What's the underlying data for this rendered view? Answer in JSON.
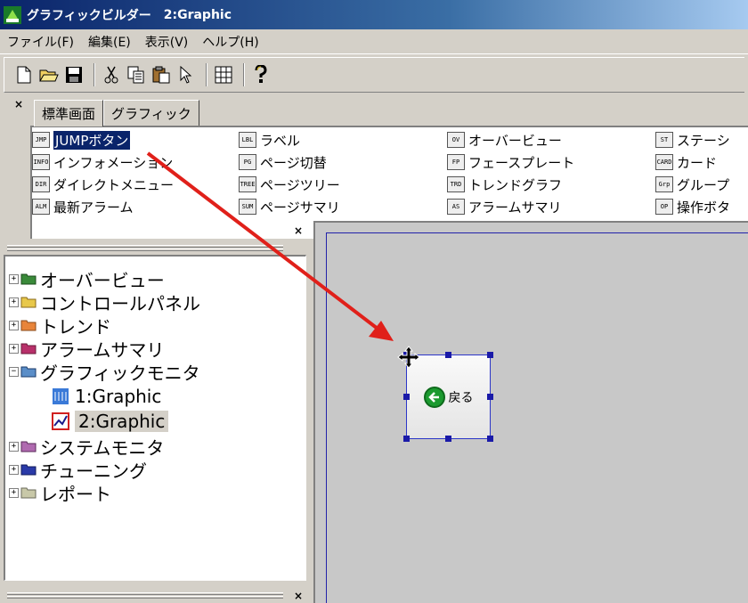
{
  "window": {
    "title_app": "グラフィックビルダー",
    "title_doc": "2:Graphic"
  },
  "menu": [
    "ファイル(F)",
    "編集(E)",
    "表示(V)",
    "ヘルプ(H)"
  ],
  "toolbar": {
    "icons": [
      "new-file-icon",
      "open-folder-icon",
      "save-icon",
      "cut-icon",
      "copy-icon",
      "paste-icon",
      "pointer-icon",
      "grid-icon",
      "help-icon"
    ]
  },
  "palette": {
    "close": "×",
    "tabs": [
      "標準画面",
      "グラフィック"
    ],
    "items": [
      {
        "label": "JUMPボタン",
        "icon": "jump-button-icon",
        "selected": true
      },
      {
        "label": "インフォメーション",
        "icon": "information-icon"
      },
      {
        "label": "ダイレクトメニュー",
        "icon": "direct-menu-icon"
      },
      {
        "label": "最新アラーム",
        "icon": "latest-alarm-icon"
      },
      {
        "label": "ラベル",
        "icon": "label-icon"
      },
      {
        "label": "ページ切替",
        "icon": "page-switch-icon"
      },
      {
        "label": "ページツリー",
        "icon": "page-tree-icon"
      },
      {
        "label": "ページサマリ",
        "icon": "page-summary-icon"
      },
      {
        "label": "オーバービュー",
        "icon": "overview-icon"
      },
      {
        "label": "フェースプレート",
        "icon": "faceplate-icon"
      },
      {
        "label": "トレンドグラフ",
        "icon": "trend-graph-icon"
      },
      {
        "label": "アラームサマリ",
        "icon": "alarm-summary-icon"
      },
      {
        "label": "ステーシ",
        "icon": "station-icon"
      },
      {
        "label": "カード",
        "icon": "card-icon"
      },
      {
        "label": "グループ",
        "icon": "group-icon"
      },
      {
        "label": "操作ボタ",
        "icon": "operation-button-icon"
      }
    ],
    "icon_text": [
      "JMP",
      "INFO",
      "DIR",
      "ALM",
      "LBL",
      "PG",
      "TREE",
      "SUM",
      "OV",
      "FP",
      "TRD",
      "AS",
      "ST",
      "CARD",
      "Grp",
      "OP"
    ]
  },
  "tree": {
    "nodes": [
      {
        "label": "オーバービュー",
        "folder_color": "#3a8a3a",
        "expander": "+"
      },
      {
        "label": "コントロールパネル",
        "folder_color": "#e8c84a",
        "expander": "+"
      },
      {
        "label": "トレンド",
        "folder_color": "#e8843a",
        "expander": "+"
      },
      {
        "label": "アラームサマリ",
        "folder_color": "#b8306a",
        "expander": "+"
      },
      {
        "label": "グラフィックモニタ",
        "folder_color": "#5b8ec8",
        "expander": "−"
      },
      {
        "label": "1:Graphic",
        "child": true
      },
      {
        "label": "2:Graphic",
        "child": true,
        "selected": true
      },
      {
        "label": "システムモニタ",
        "folder_color": "#b06ab0",
        "expander": "+"
      },
      {
        "label": "チューニング",
        "folder_color": "#2a3aa8",
        "expander": "+"
      },
      {
        "label": "レポート",
        "folder_color": "#c8c8a8",
        "expander": "+"
      }
    ]
  },
  "canvas": {
    "jump_button": {
      "label": "戻る",
      "icon": "back-arrow-icon"
    }
  },
  "panel_close": "×",
  "colors": {
    "selection": "#0a246a",
    "handle": "#1a1aa8",
    "drag_arrow": "#e0201a"
  }
}
